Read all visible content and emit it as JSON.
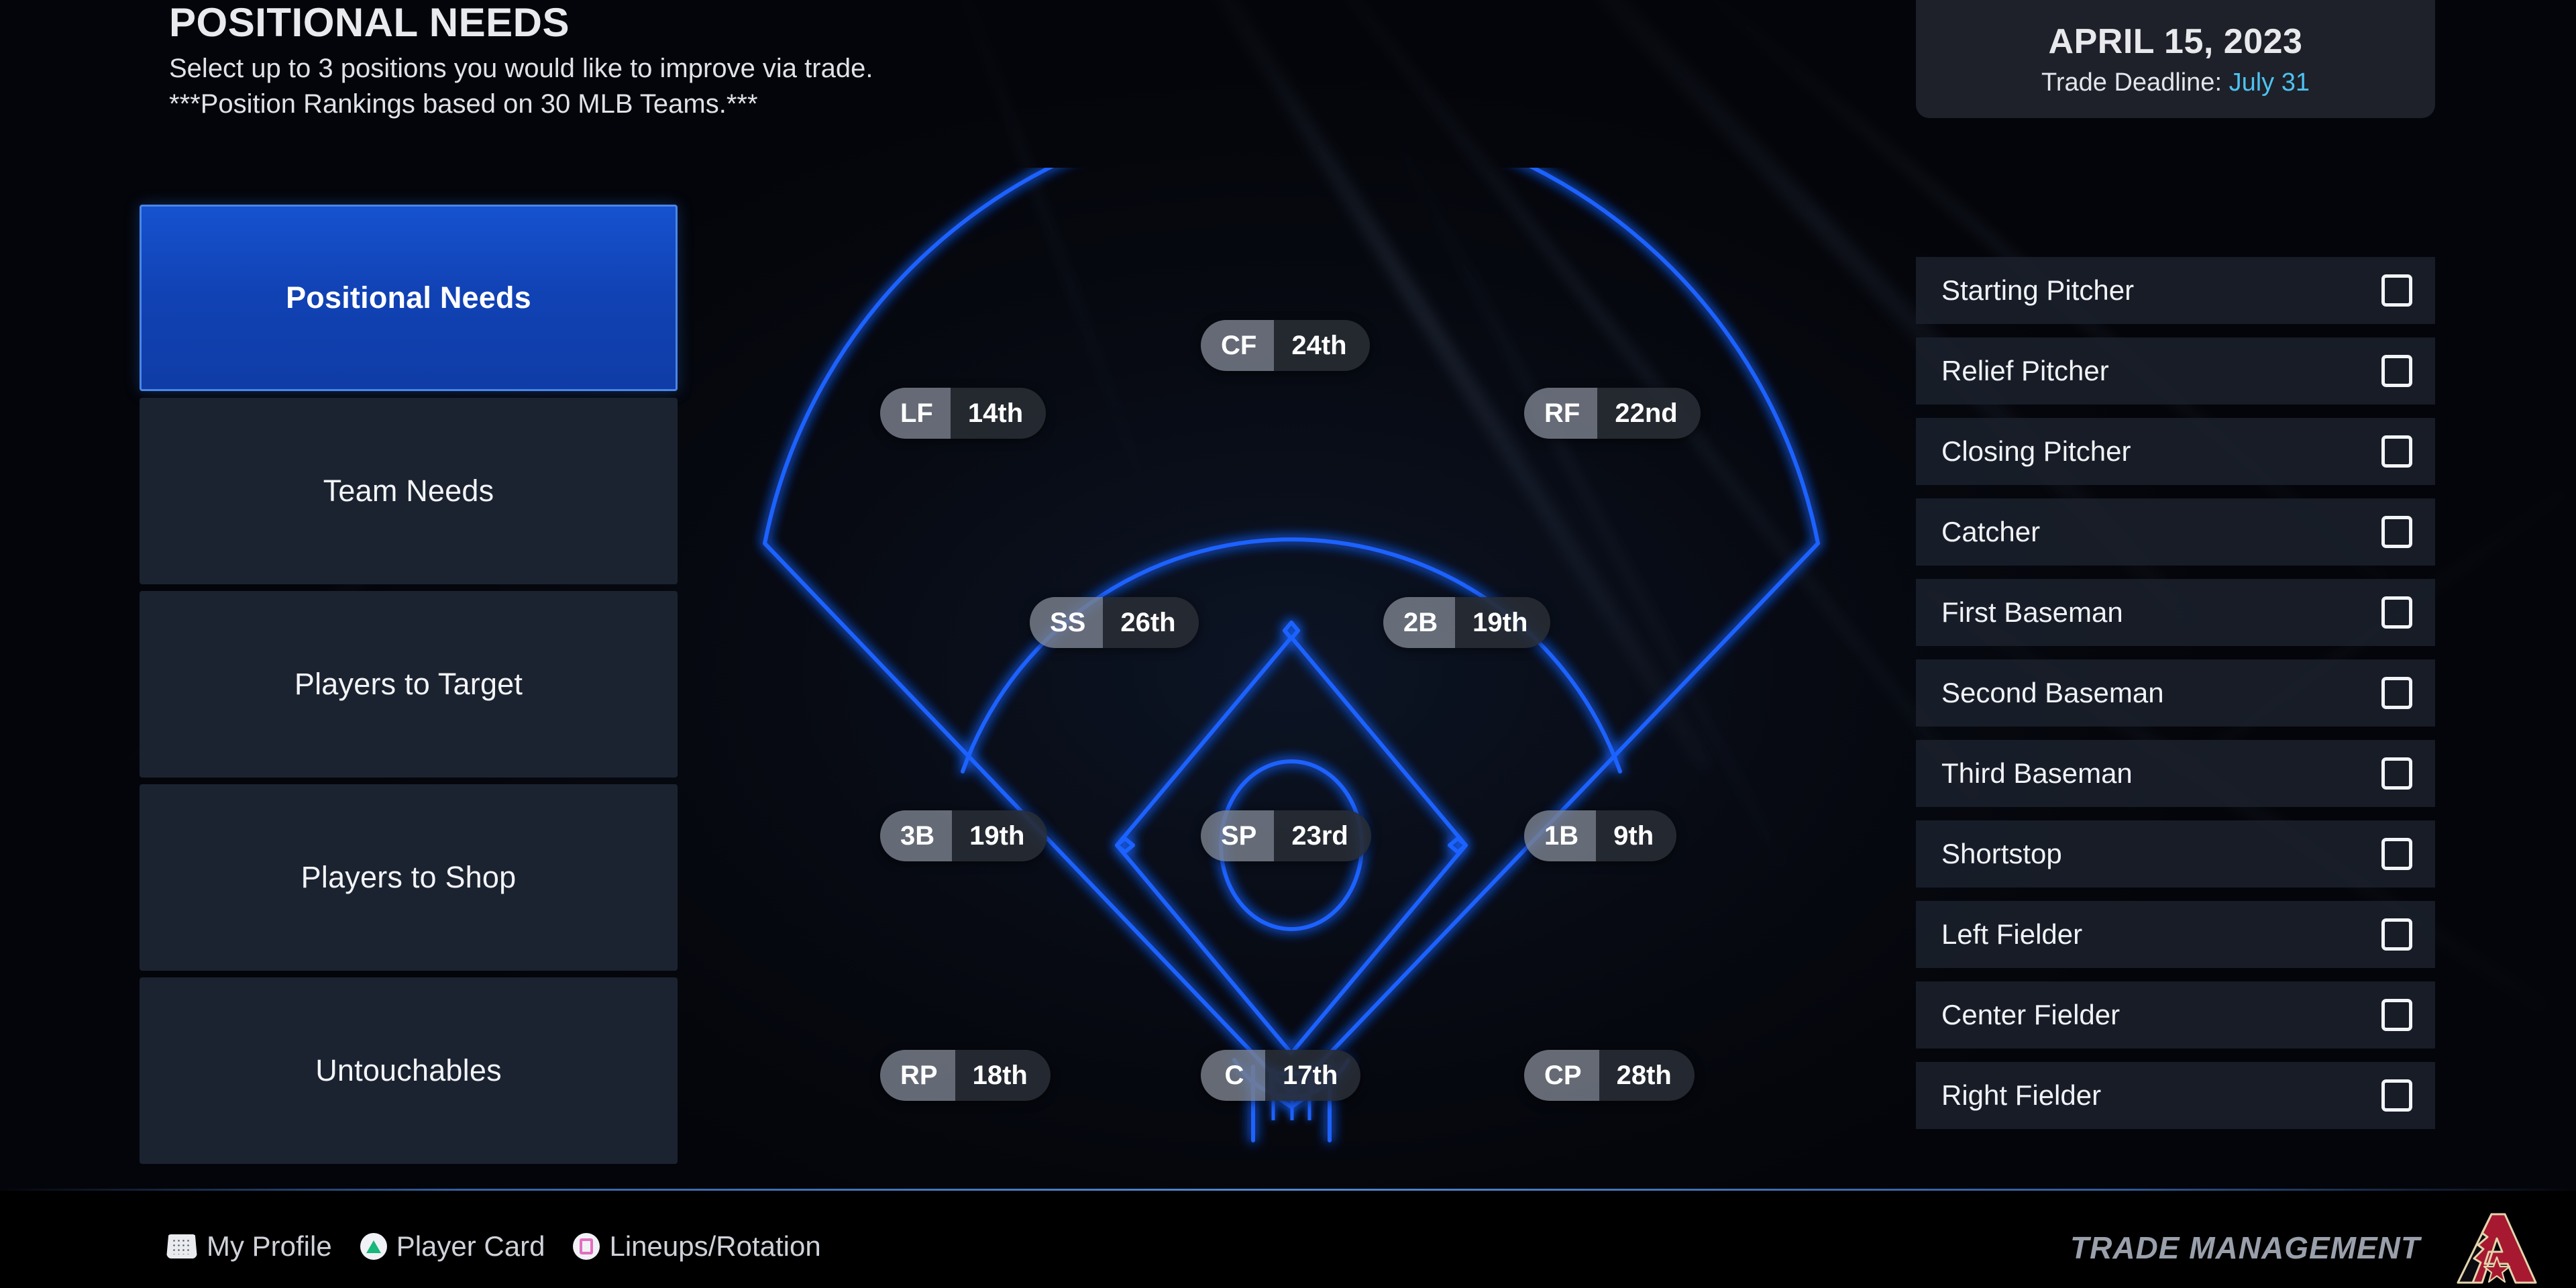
{
  "header": {
    "title": "POSITIONAL NEEDS",
    "subtitle_line1": "Select up to 3 positions you would like to improve via trade.",
    "subtitle_line2": "***Position Rankings based on 30 MLB Teams.***"
  },
  "date_card": {
    "date": "APRIL 15, 2023",
    "deadline_label": "Trade Deadline:",
    "deadline_value": "July 31",
    "deadline_color": "#4ec2f0"
  },
  "sidebar": {
    "items": [
      {
        "label": "Positional Needs",
        "selected": true
      },
      {
        "label": "Team Needs",
        "selected": false
      },
      {
        "label": "Players to Target",
        "selected": false
      },
      {
        "label": "Players to Shop",
        "selected": false
      },
      {
        "label": "Untouchables",
        "selected": false
      }
    ],
    "selected_color": "#1142b4",
    "selected_border": "#4a86e8"
  },
  "field": {
    "line_color": "#1a62ff",
    "positions": [
      {
        "abbr": "CF",
        "rank": "24th"
      },
      {
        "abbr": "LF",
        "rank": "14th"
      },
      {
        "abbr": "RF",
        "rank": "22nd"
      },
      {
        "abbr": "SS",
        "rank": "26th"
      },
      {
        "abbr": "2B",
        "rank": "19th"
      },
      {
        "abbr": "3B",
        "rank": "19th"
      },
      {
        "abbr": "SP",
        "rank": "23rd"
      },
      {
        "abbr": "1B",
        "rank": "9th"
      },
      {
        "abbr": "RP",
        "rank": "18th"
      },
      {
        "abbr": "C",
        "rank": "17th"
      },
      {
        "abbr": "CP",
        "rank": "28th"
      }
    ]
  },
  "checklist": {
    "rows": [
      {
        "label": "Starting Pitcher",
        "checked": false
      },
      {
        "label": "Relief Pitcher",
        "checked": false
      },
      {
        "label": "Closing Pitcher",
        "checked": false
      },
      {
        "label": "Catcher",
        "checked": false
      },
      {
        "label": "First Baseman",
        "checked": false
      },
      {
        "label": "Second Baseman",
        "checked": false
      },
      {
        "label": "Third Baseman",
        "checked": false
      },
      {
        "label": "Shortstop",
        "checked": false
      },
      {
        "label": "Left Fielder",
        "checked": false
      },
      {
        "label": "Center Fielder",
        "checked": false
      },
      {
        "label": "Right Fielder",
        "checked": false
      }
    ]
  },
  "bottom_bar": {
    "actions": [
      {
        "icon": "touchpad-icon",
        "label": "My Profile"
      },
      {
        "icon": "triangle-button-icon",
        "label": "Player Card"
      },
      {
        "icon": "square-button-icon",
        "label": "Lineups/Rotation"
      }
    ],
    "screen_label": "TRADE MANAGEMENT",
    "team_logo": "arizona-diamondbacks-logo"
  }
}
